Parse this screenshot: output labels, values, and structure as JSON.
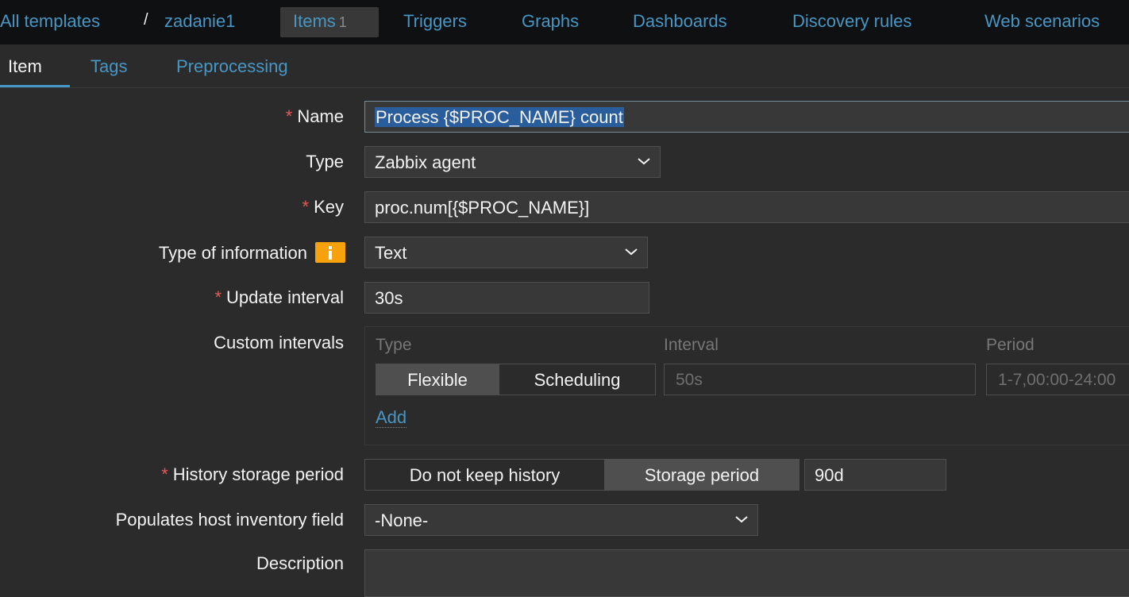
{
  "breadcrumb": {
    "all_templates": "All templates",
    "separator": "/",
    "template": "zadanie1"
  },
  "nav": {
    "items_label": "Items",
    "items_count": "1",
    "triggers": "Triggers",
    "graphs": "Graphs",
    "dashboards": "Dashboards",
    "discovery_rules": "Discovery rules",
    "web_scenarios": "Web scenarios"
  },
  "tabs": {
    "item": "Item",
    "tags": "Tags",
    "preprocessing": "Preprocessing"
  },
  "form": {
    "name_label": "Name",
    "name_value": "Process {$PROC_NAME} count",
    "type_label": "Type",
    "type_value": "Zabbix agent",
    "key_label": "Key",
    "key_value": "proc.num[{$PROC_NAME}]",
    "type_info_label": "Type of information",
    "type_info_value": "Text",
    "update_interval_label": "Update interval",
    "update_interval_value": "30s",
    "custom_intervals_label": "Custom intervals",
    "custom_intervals": {
      "col_type": "Type",
      "col_interval": "Interval",
      "col_period": "Period",
      "flexible": "Flexible",
      "scheduling": "Scheduling",
      "interval_placeholder": "50s",
      "period_placeholder": "1-7,00:00-24:00",
      "add": "Add"
    },
    "history_label": "History storage period",
    "history_do_not_keep": "Do not keep history",
    "history_storage_period": "Storage period",
    "history_value": "90d",
    "inventory_label": "Populates host inventory field",
    "inventory_value": "-None-",
    "description_label": "Description"
  },
  "colors": {
    "background": "#2b2b2b",
    "topbar": "#0e1012",
    "link": "#4796c4",
    "required": "#e45959",
    "info": "#f7a20d",
    "selection": "#2a5d9c"
  }
}
